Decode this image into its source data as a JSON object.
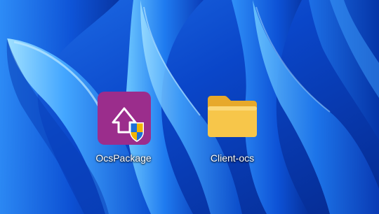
{
  "desktop": {
    "icons": [
      {
        "label": "OcsPackage",
        "icon": "installer-package-icon",
        "accent": "#9b2d8c",
        "shield_colors": [
          "#1e6fd9",
          "#f2b500"
        ]
      },
      {
        "label": "Client-ocs",
        "icon": "folder-icon",
        "accent": "#f6c244"
      }
    ]
  },
  "colors": {
    "wallpaper_dark": "#062a8a",
    "wallpaper_light": "#3fb0ff"
  }
}
